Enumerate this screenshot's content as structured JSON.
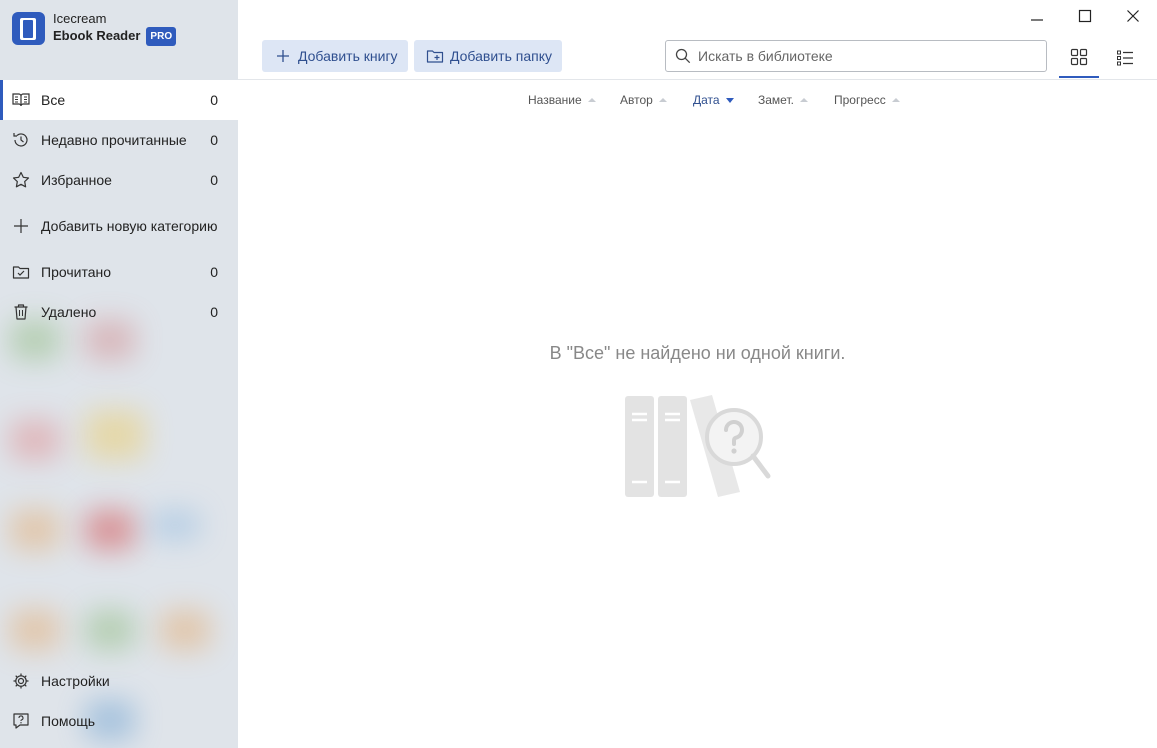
{
  "app": {
    "title_line1": "Icecream",
    "title_line2": "Ebook Reader",
    "badge": "PRO"
  },
  "sidebar": {
    "items": [
      {
        "label": "Все",
        "count": "0",
        "icon": "book-open-icon",
        "active": true
      },
      {
        "label": "Недавно прочитанные",
        "count": "0",
        "icon": "history-icon"
      },
      {
        "label": "Избранное",
        "count": "0",
        "icon": "star-icon"
      },
      {
        "label": "Добавить новую категорию",
        "icon": "plus-icon"
      },
      {
        "label": "Прочитано",
        "count": "0",
        "icon": "folder-check-icon"
      },
      {
        "label": "Удалено",
        "count": "0",
        "icon": "trash-icon"
      }
    ],
    "bottom": [
      {
        "label": "Настройки",
        "icon": "gear-icon"
      },
      {
        "label": "Помощь",
        "icon": "help-icon"
      }
    ]
  },
  "toolbar": {
    "add_book": "Добавить книгу",
    "add_folder": "Добавить папку",
    "search_placeholder": "Искать в библиотеке"
  },
  "sort": {
    "columns": [
      {
        "label": "Название",
        "active": false
      },
      {
        "label": "Автор",
        "active": false
      },
      {
        "label": "Дата",
        "active": true
      },
      {
        "label": "Замет.",
        "active": false
      },
      {
        "label": "Прогресс",
        "active": false
      }
    ]
  },
  "main": {
    "empty_message": "В \"Все\" не найдено ни одной книги."
  },
  "colors": {
    "accent": "#2f5bbd",
    "sidebar_bg": "#dfe4ea",
    "button_bg": "#dde6f5"
  }
}
